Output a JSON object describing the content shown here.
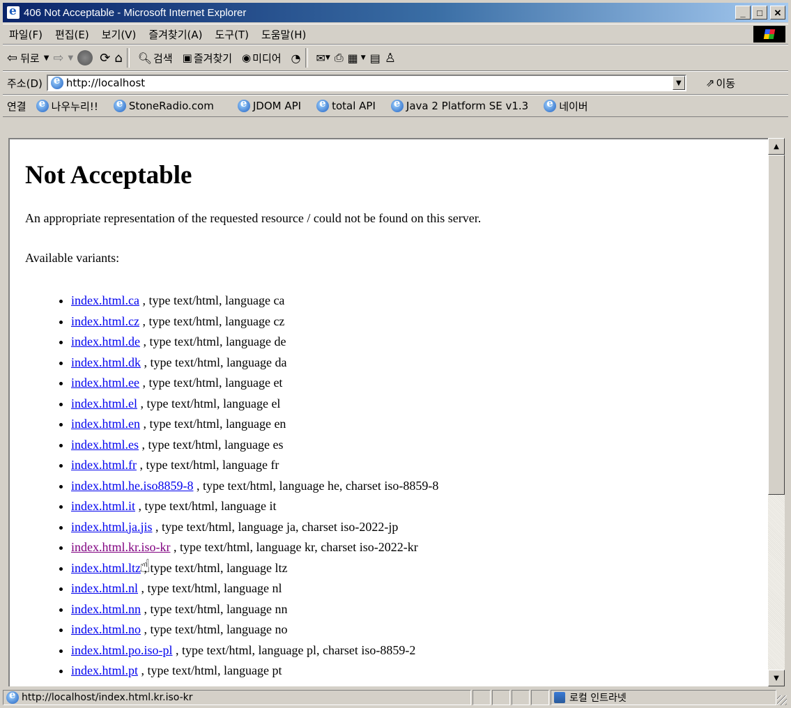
{
  "window": {
    "title": "406 Not Acceptable - Microsoft Internet Explorer"
  },
  "menu": [
    {
      "label": "파일(F)"
    },
    {
      "label": "편집(E)"
    },
    {
      "label": "보기(V)"
    },
    {
      "label": "즐겨찾기(A)"
    },
    {
      "label": "도구(T)"
    },
    {
      "label": "도움말(H)"
    }
  ],
  "toolbar": {
    "back": "뒤로",
    "search": "검색",
    "favorites": "즐겨찾기",
    "media": "미디어"
  },
  "address": {
    "label": "주소(D)",
    "value": "http://localhost",
    "go": "이동"
  },
  "links": {
    "label": "연결",
    "items": [
      "나우누리!!",
      "StoneRadio.com",
      "JDOM API",
      "total API",
      "Java 2 Platform SE v1.3",
      "네이버"
    ]
  },
  "page": {
    "heading": "Not Acceptable",
    "message": "An appropriate representation of the requested resource / could not be found on this server.",
    "variants_label": "Available variants:",
    "variants": [
      {
        "link": "index.html.ca",
        "desc": " , type text/html, language ca"
      },
      {
        "link": "index.html.cz",
        "desc": " , type text/html, language cz"
      },
      {
        "link": "index.html.de",
        "desc": " , type text/html, language de"
      },
      {
        "link": "index.html.dk",
        "desc": " , type text/html, language da"
      },
      {
        "link": "index.html.ee",
        "desc": " , type text/html, language et"
      },
      {
        "link": "index.html.el",
        "desc": " , type text/html, language el"
      },
      {
        "link": "index.html.en",
        "desc": " , type text/html, language en"
      },
      {
        "link": "index.html.es",
        "desc": " , type text/html, language es"
      },
      {
        "link": "index.html.fr",
        "desc": " , type text/html, language fr"
      },
      {
        "link": "index.html.he.iso8859-8",
        "desc": " , type text/html, language he, charset iso-8859-8"
      },
      {
        "link": "index.html.it",
        "desc": " , type text/html, language it"
      },
      {
        "link": "index.html.ja.jis",
        "desc": " , type text/html, language ja, charset iso-2022-jp"
      },
      {
        "link": "index.html.kr.iso-kr",
        "desc": " , type text/html, language kr, charset iso-2022-kr"
      },
      {
        "link": "index.html.ltz",
        "desc": " , type text/html, language ltz"
      },
      {
        "link": "index.html.nl",
        "desc": " , type text/html, language nl"
      },
      {
        "link": "index.html.nn",
        "desc": " , type text/html, language nn"
      },
      {
        "link": "index.html.no",
        "desc": " , type text/html, language no"
      },
      {
        "link": "index.html.po.iso-pl",
        "desc": " , type text/html, language pl, charset iso-8859-2"
      },
      {
        "link": "index.html.pt",
        "desc": " , type text/html, language pt"
      }
    ]
  },
  "status": {
    "url": "http://localhost/index.html.kr.iso-kr",
    "zone": "로컬 인트라넷"
  }
}
